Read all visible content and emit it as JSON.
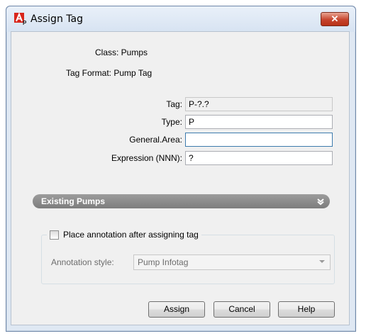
{
  "window": {
    "title": "Assign Tag",
    "close_label": "✕"
  },
  "info": {
    "class_label": "Class: Pumps",
    "tag_format_label": "Tag Format: Pump Tag"
  },
  "fields": {
    "tag": {
      "label": "Tag:",
      "value": "P-?.?"
    },
    "type": {
      "label": "Type:",
      "value": "P"
    },
    "general_area": {
      "label": "General.Area:",
      "value": ""
    },
    "expression": {
      "label": "Expression (NNN):",
      "value": "?"
    }
  },
  "existing_section": {
    "label": "Existing Pumps"
  },
  "annotation": {
    "checkbox_label": "Place annotation after assigning tag",
    "checked": false,
    "style_label": "Annotation style:",
    "style_value": "Pump Infotag"
  },
  "buttons": {
    "assign": "Assign",
    "cancel": "Cancel",
    "help": "Help"
  },
  "colors": {
    "banner": "#8c8c8c",
    "close": "#c6442d",
    "focus_border": "#3d7bad"
  }
}
